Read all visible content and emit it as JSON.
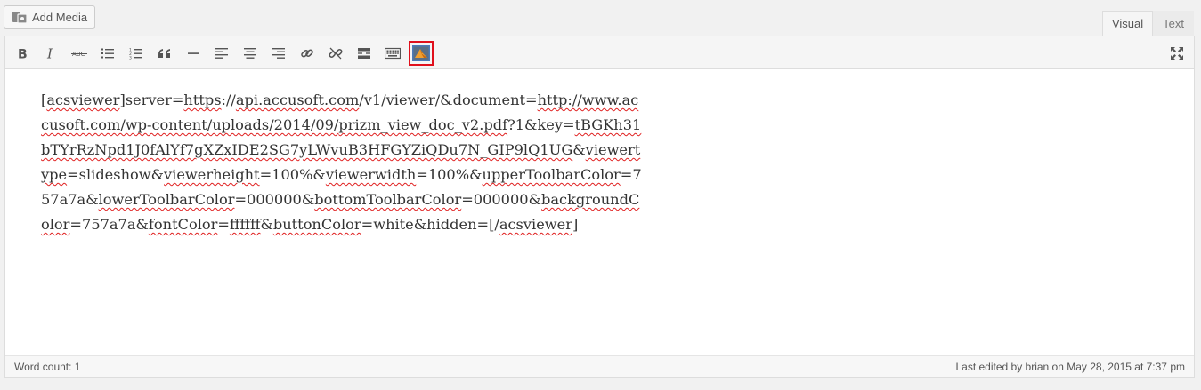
{
  "header": {
    "add_media_label": "Add Media",
    "tabs": [
      {
        "label": "Visual",
        "active": true
      },
      {
        "label": "Text",
        "active": false
      }
    ]
  },
  "toolbar": {
    "buttons": [
      {
        "name": "bold-button",
        "icon": "bold-icon"
      },
      {
        "name": "italic-button",
        "icon": "italic-icon"
      },
      {
        "name": "strikethrough-button",
        "icon": "strikethrough-icon",
        "glyph": "ABC"
      },
      {
        "name": "bulleted-list-button",
        "icon": "bulleted-list-icon"
      },
      {
        "name": "numbered-list-button",
        "icon": "numbered-list-icon"
      },
      {
        "name": "blockquote-button",
        "icon": "blockquote-icon"
      },
      {
        "name": "horizontal-line-button",
        "icon": "horizontal-line-icon"
      },
      {
        "name": "align-left-button",
        "icon": "align-left-icon"
      },
      {
        "name": "align-center-button",
        "icon": "align-center-icon"
      },
      {
        "name": "align-right-button",
        "icon": "align-right-icon"
      },
      {
        "name": "insert-link-button",
        "icon": "link-icon"
      },
      {
        "name": "remove-link-button",
        "icon": "unlink-icon"
      },
      {
        "name": "read-more-button",
        "icon": "read-more-icon"
      },
      {
        "name": "toolbar-toggle-button",
        "icon": "keyboard-icon"
      },
      {
        "name": "acsviewer-button",
        "icon": "acsviewer-icon",
        "highlighted": true
      }
    ],
    "fullscreen_icon": "fullscreen-icon"
  },
  "content": {
    "segments": [
      {
        "t": "[",
        "s": false
      },
      {
        "t": "acsviewer",
        "s": true
      },
      {
        "t": "]server=",
        "s": false
      },
      {
        "t": "https",
        "s": true
      },
      {
        "t": "://",
        "s": false
      },
      {
        "t": "api.accusoft.com",
        "s": true
      },
      {
        "t": "/v1/viewer/&document=",
        "s": false
      },
      {
        "t": "http://www.accusoft.com/wp-content/uploads/2014/09/",
        "s": true
      },
      {
        "t": "prizm_view_doc_v2.pdf",
        "s": true
      },
      {
        "t": "?1&key=",
        "s": false
      },
      {
        "t": "tBGKh31bTYrRzNpd1J0fAlYf7gXZxIDE2SG7yLWvuB3HFGYZiQDu7N_GIP9lQ1UG",
        "s": true
      },
      {
        "t": "&",
        "s": false
      },
      {
        "t": "viewertype",
        "s": true
      },
      {
        "t": "=slideshow&",
        "s": false
      },
      {
        "t": "viewerheight",
        "s": true
      },
      {
        "t": "=100%&",
        "s": false
      },
      {
        "t": "viewerwidth",
        "s": true
      },
      {
        "t": "=100%&",
        "s": false
      },
      {
        "t": "upperToolbarColor",
        "s": true
      },
      {
        "t": "=757a7a&",
        "s": false
      },
      {
        "t": "lowerToolbarColor",
        "s": true
      },
      {
        "t": "=000000&",
        "s": false
      },
      {
        "t": "bottomToolbarColor",
        "s": true
      },
      {
        "t": "=000000&",
        "s": false
      },
      {
        "t": "backgroundColor",
        "s": true
      },
      {
        "t": "=757a7a&",
        "s": false
      },
      {
        "t": "fontColor",
        "s": true
      },
      {
        "t": "=",
        "s": false
      },
      {
        "t": "ffffff",
        "s": true
      },
      {
        "t": "&",
        "s": false
      },
      {
        "t": "buttonColor",
        "s": true
      },
      {
        "t": "=white&hidden=[/",
        "s": false
      },
      {
        "t": "acsviewer",
        "s": true
      },
      {
        "t": "]",
        "s": false
      }
    ]
  },
  "status": {
    "word_count": "Word count: 1",
    "last_edited": "Last edited by brian on May 28, 2015 at 7:37 pm"
  },
  "colors": {
    "highlight": "#e0101c",
    "spellcheck": "#e02020",
    "acsviewer_icon_bg": "#4b7bb8",
    "acsviewer_icon_fg": "#f0a030"
  }
}
